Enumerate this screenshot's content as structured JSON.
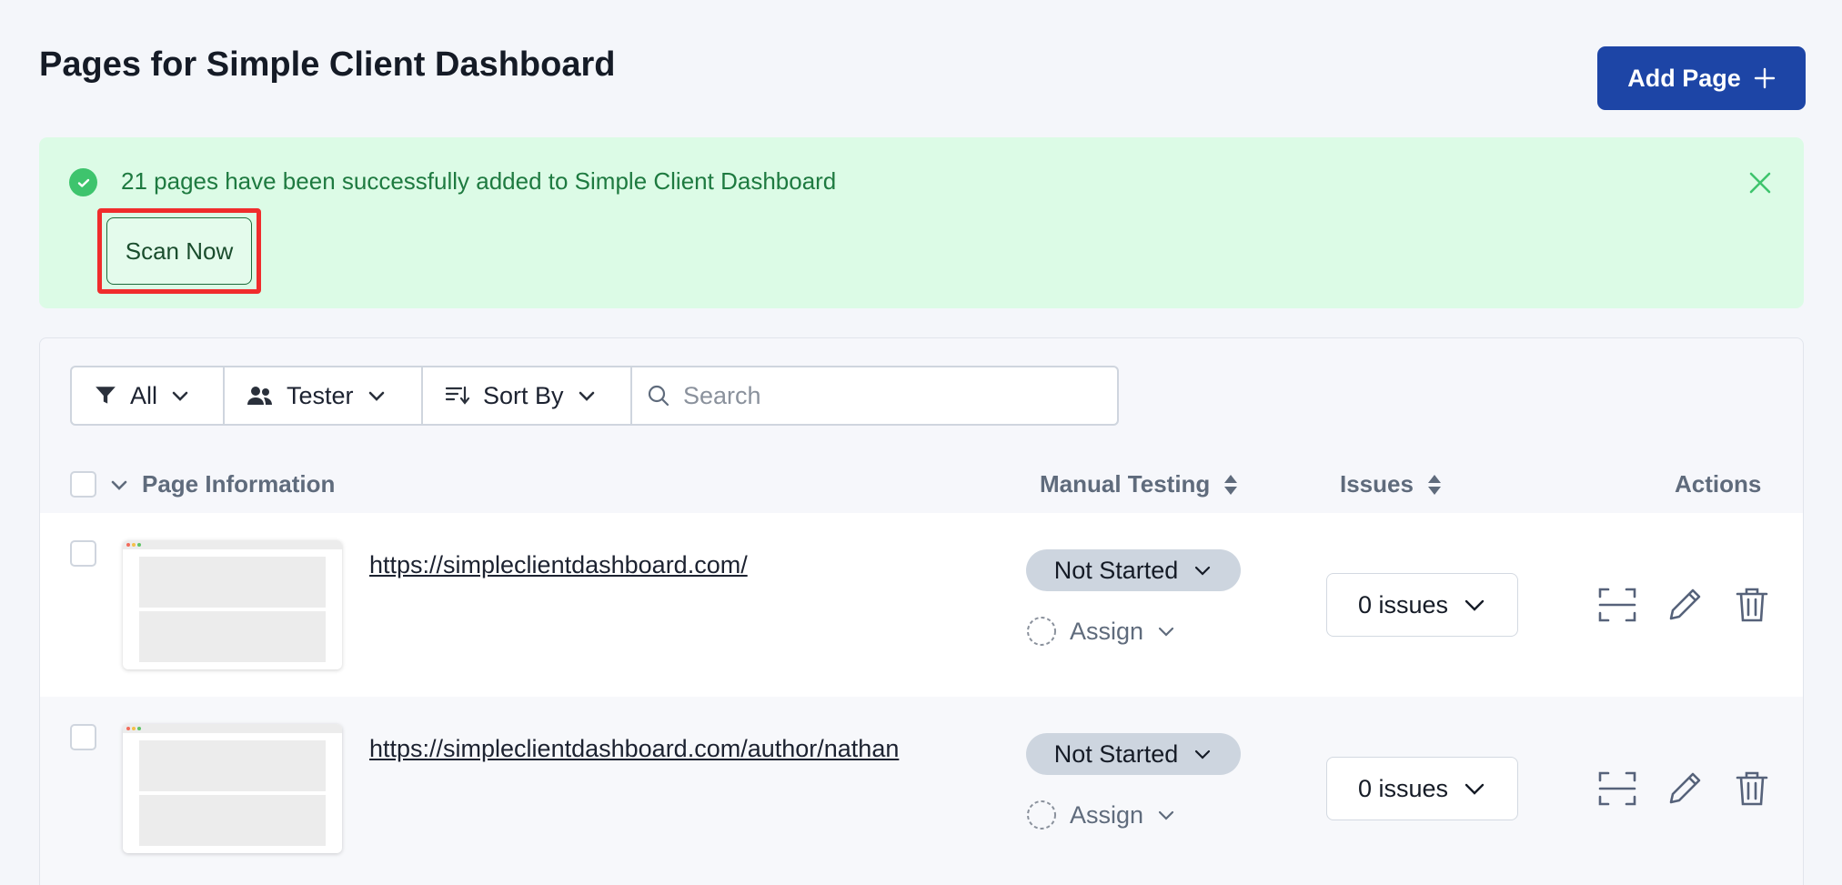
{
  "header": {
    "title": "Pages for Simple Client Dashboard",
    "add_page_label": "Add Page"
  },
  "alert": {
    "message": "21 pages have been successfully added to Simple Client Dashboard",
    "scan_label": "Scan Now"
  },
  "filters": {
    "all_label": "All",
    "tester_label": "Tester",
    "sort_label": "Sort By",
    "search_placeholder": "Search"
  },
  "columns": {
    "page_info": "Page Information",
    "manual_testing": "Manual Testing",
    "issues": "Issues",
    "actions": "Actions"
  },
  "rows": [
    {
      "url": "https://simpleclientdashboard.com/",
      "status": "Not Started",
      "assign": "Assign",
      "issues": "0 issues"
    },
    {
      "url": "https://simpleclientdashboard.com/author/nathan",
      "status": "Not Started",
      "assign": "Assign",
      "issues": "0 issues"
    }
  ],
  "colors": {
    "primary": "#1d45a6",
    "success_bg": "#dcfbe6",
    "success_text": "#1e7a40",
    "highlight": "#f02c2c",
    "pill_bg": "#cdd5df"
  },
  "icons": [
    "check-circle-icon",
    "close-icon",
    "plus-icon",
    "filter-icon",
    "users-icon",
    "sort-icon",
    "search-icon",
    "chevron-down-icon",
    "sort-arrows-icon",
    "scan-icon",
    "pencil-icon",
    "trash-icon"
  ]
}
